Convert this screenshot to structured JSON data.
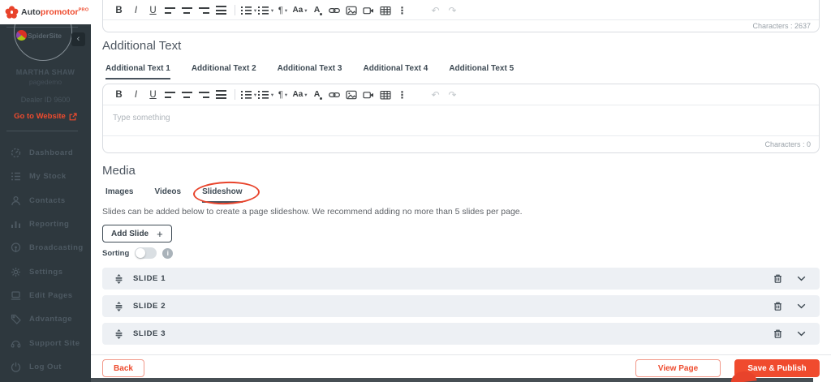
{
  "sidebar": {
    "logo": {
      "brand_prefix": "Auto",
      "brand_suffix": "promotor",
      "badge": "PRO"
    },
    "collapse_glyph": "‹",
    "profile": {
      "overlay_text": "SpiderSite",
      "name": "MARTHA SHAW",
      "subtitle": "pagedemo",
      "dealer_id": "Dealer ID 9600",
      "website_label": "Go to Website"
    },
    "menu": [
      {
        "label": "Dashboard",
        "icon": "dashboard-icon"
      },
      {
        "label": "My Stock",
        "icon": "my-stock-icon"
      },
      {
        "label": "Contacts",
        "icon": "contacts-icon"
      },
      {
        "label": "Reporting",
        "icon": "reporting-icon"
      },
      {
        "label": "Broadcasting",
        "icon": "broadcasting-icon"
      },
      {
        "label": "Settings",
        "icon": "settings-icon"
      },
      {
        "label": "Edit Pages",
        "icon": "edit-pages-icon"
      },
      {
        "label": "Advantage",
        "icon": "advantage-icon"
      },
      {
        "label": "Support Site",
        "icon": "support-site-icon"
      },
      {
        "label": "Log Out",
        "icon": "log-out-icon"
      }
    ]
  },
  "toolbar": {
    "bold": "B",
    "italic": "I",
    "underline": "U",
    "paragraph": "¶",
    "font_size": "Aa",
    "font_color": "A",
    "more": "⋮",
    "undo": "↶",
    "redo": "↷",
    "caret": "▾",
    "icons": [
      "bold",
      "italic",
      "underline",
      "align-left",
      "align-center",
      "align-right",
      "justify",
      "ordered-list",
      "unordered-list",
      "paragraph-format",
      "font-size",
      "font-color",
      "insert-link",
      "insert-image",
      "insert-video",
      "insert-table",
      "more-options",
      "undo",
      "redo"
    ]
  },
  "editor_top": {
    "characters_label": "Characters : 2637"
  },
  "additional_text": {
    "heading": "Additional Text",
    "tabs": [
      "Additional Text 1",
      "Additional Text 2",
      "Additional Text 3",
      "Additional Text 4",
      "Additional Text 5"
    ],
    "active_tab": "Additional Text 1",
    "editor": {
      "placeholder": "Type something",
      "characters_label": "Characters : 0"
    }
  },
  "media": {
    "heading": "Media",
    "tabs": [
      "Images",
      "Videos",
      "Slideshow"
    ],
    "active_tab": "Slideshow",
    "description": "Slides can be added below to create a page slideshow. We recommend adding no more than 5 slides per page.",
    "add_slide_label": "Add Slide",
    "add_slide_glyph": "+",
    "sorting_label": "Sorting",
    "info_glyph": "i",
    "slides": [
      {
        "label": "SLIDE 1"
      },
      {
        "label": "SLIDE 2"
      },
      {
        "label": "SLIDE 3"
      }
    ]
  },
  "footer": {
    "back": "Back",
    "view_page": "View Page",
    "save_publish": "Save & Publish"
  },
  "colors": {
    "accent_red": "#ee4b2e",
    "sidebar_bg": "#2e383e",
    "slide_row_bg": "#edf0f4",
    "annotation_red": "#e8432b"
  }
}
